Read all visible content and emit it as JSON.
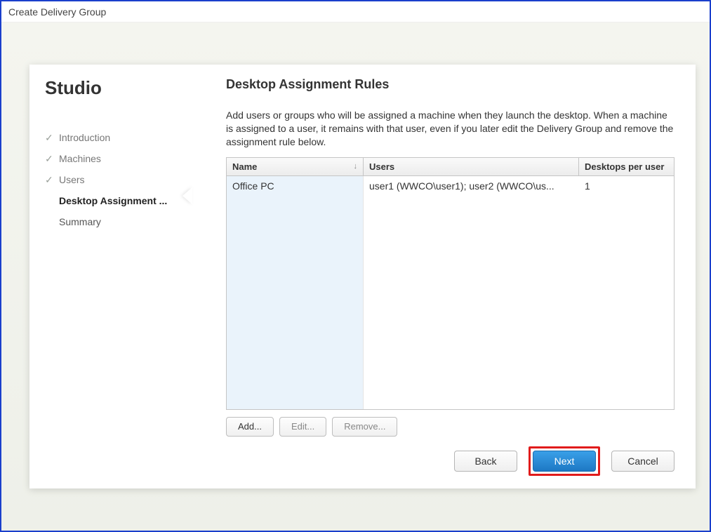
{
  "window": {
    "title": "Create Delivery Group"
  },
  "sidebar": {
    "appName": "Studio",
    "steps": [
      {
        "label": "Introduction",
        "done": true
      },
      {
        "label": "Machines",
        "done": true
      },
      {
        "label": "Users",
        "done": true
      },
      {
        "label": "Desktop Assignment ...",
        "active": true
      },
      {
        "label": "Summary"
      }
    ]
  },
  "page": {
    "title": "Desktop Assignment Rules",
    "description": "Add users or groups who will be assigned a machine when they launch the desktop. When a machine is assigned to a user, it remains with that user, even if you later edit the Delivery Group and remove the assignment rule below."
  },
  "table": {
    "columns": {
      "name": "Name",
      "users": "Users",
      "dpu": "Desktops per user"
    },
    "rows": [
      {
        "name": "Office PC",
        "users": "user1 (WWCO\\user1); user2 (WWCO\\us...",
        "dpu": "1"
      }
    ]
  },
  "buttons": {
    "add": "Add...",
    "edit": "Edit...",
    "remove": "Remove...",
    "back": "Back",
    "next": "Next",
    "cancel": "Cancel"
  }
}
